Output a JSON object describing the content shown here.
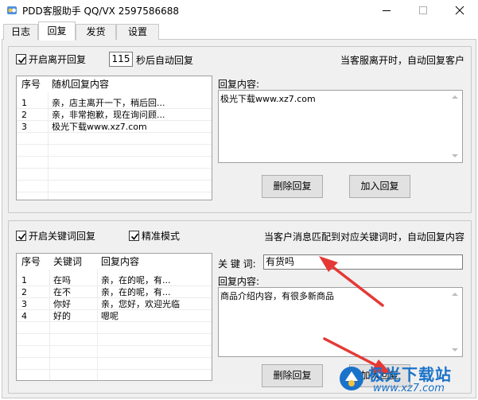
{
  "window": {
    "title": "PDD客服助手 QQ/VX 2597586688"
  },
  "tabs": [
    {
      "label": "日志",
      "active": false
    },
    {
      "label": "回复",
      "active": true
    },
    {
      "label": "发货",
      "active": false
    },
    {
      "label": "设置",
      "active": false
    }
  ],
  "leave_reply": {
    "enable_label": "开启离开回复",
    "enabled": true,
    "delay_value": "115",
    "delay_suffix": "秒后自动回复",
    "hint": "当客服离开时，自动回复客户",
    "columns": [
      "序号",
      "随机回复内容"
    ],
    "rows": [
      {
        "index": "1",
        "content": "亲，店主离开一下，稍后回..."
      },
      {
        "index": "2",
        "content": "亲，非常抱歉，现在询问顾..."
      },
      {
        "index": "3",
        "content": "极光下载www.xz7.com"
      }
    ],
    "content_label": "回复内容:",
    "content_value": "极光下载www.xz7.com",
    "delete_label": "删除回复",
    "add_label": "加入回复"
  },
  "keyword_reply": {
    "enable_label": "开启关键词回复",
    "enabled": true,
    "exact_label": "精准模式",
    "exact_enabled": true,
    "hint": "当客户消息匹配到对应关键词时，自动回复内容",
    "columns": [
      "序号",
      "关键词",
      "回复内容"
    ],
    "rows": [
      {
        "index": "1",
        "keyword": "在吗",
        "content": "亲，在的呢，有..."
      },
      {
        "index": "2",
        "keyword": "在不",
        "content": "亲，在的呢，有..."
      },
      {
        "index": "3",
        "keyword": "你好",
        "content": "亲，您好，欢迎光临"
      },
      {
        "index": "4",
        "keyword": "好的",
        "content": "嗯呢"
      }
    ],
    "keyword_label": "关 键 词:",
    "keyword_value": "有货吗",
    "content_label": "回复内容:",
    "content_value": "商品介绍内容，有很多新商品",
    "delete_label": "删除回复",
    "add_label": "加入回复"
  },
  "watermark": {
    "name": "极光下载站",
    "url": "www.xz7.com"
  },
  "colors": {
    "arrow": "#e53935",
    "watermark": "#1a73c9"
  }
}
